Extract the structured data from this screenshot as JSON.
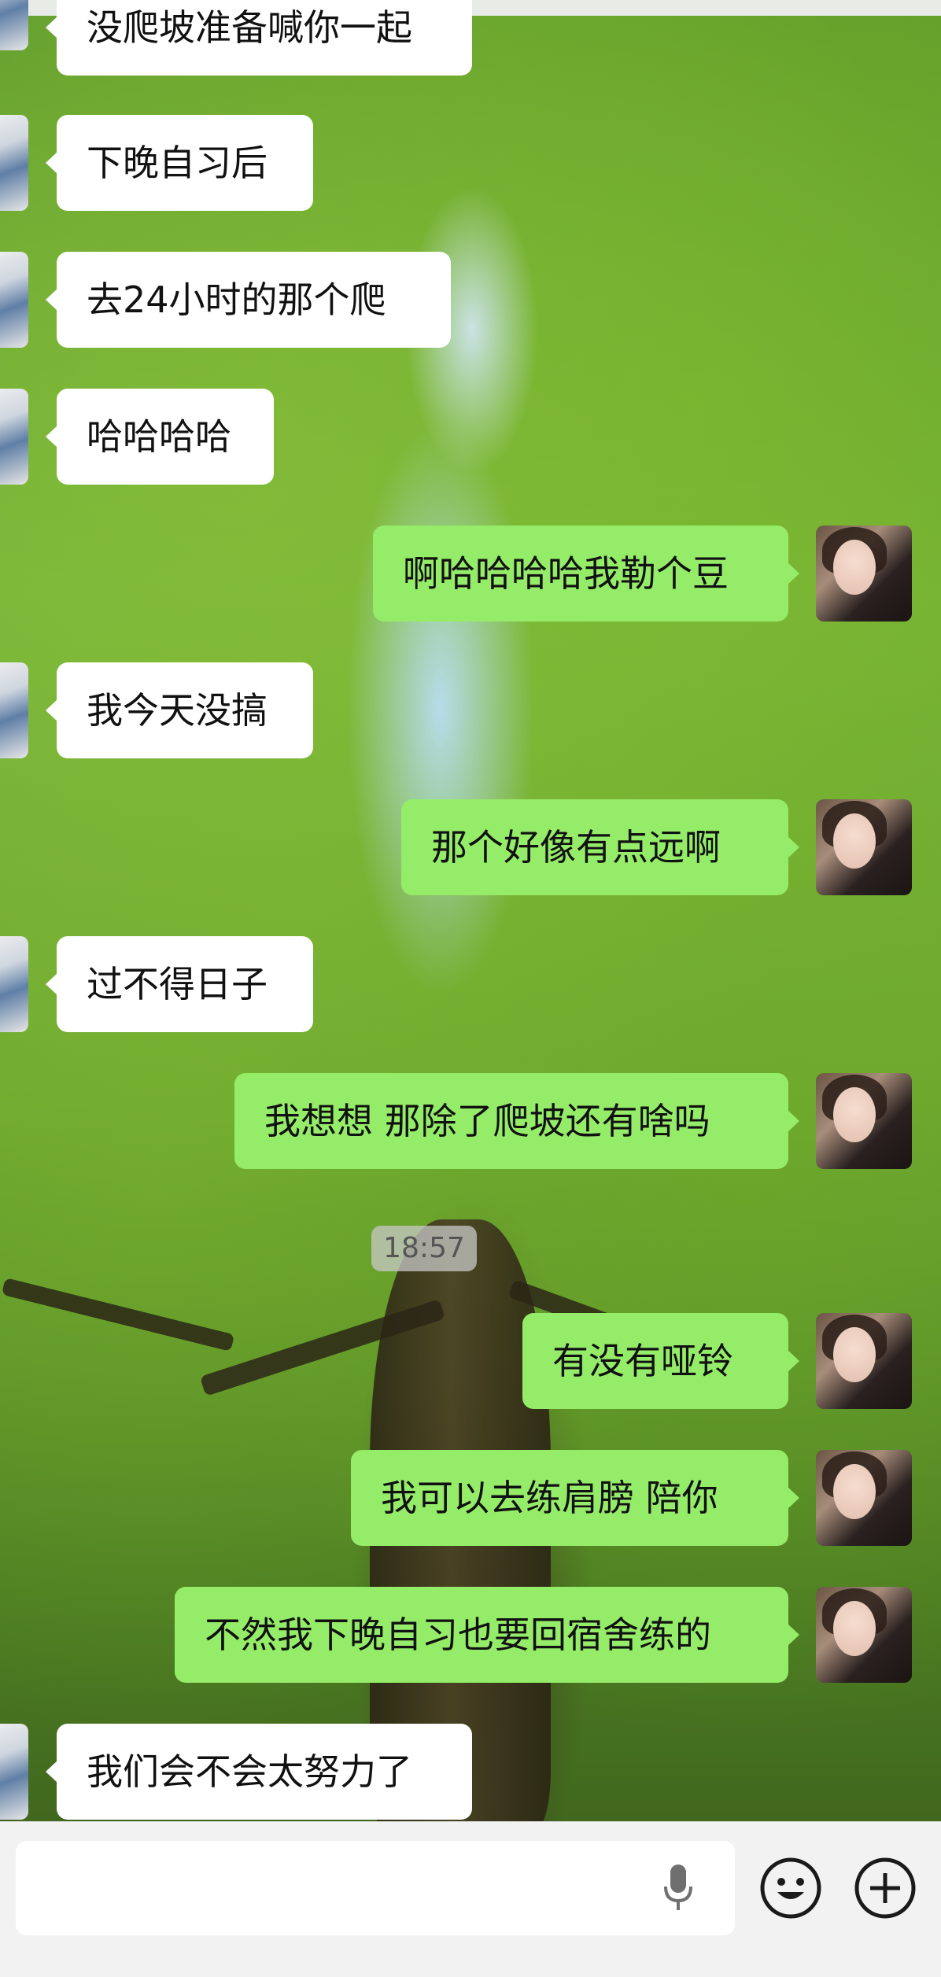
{
  "timestamp": "18:57",
  "messages": [
    {
      "side": "left",
      "text": "没爬坡准备喊你一起"
    },
    {
      "side": "left",
      "text": "下晚自习后"
    },
    {
      "side": "left",
      "text": "去24小时的那个爬"
    },
    {
      "side": "left",
      "text": "哈哈哈哈"
    },
    {
      "side": "right",
      "text": "啊哈哈哈哈我勒个豆"
    },
    {
      "side": "left",
      "text": "我今天没搞"
    },
    {
      "side": "right",
      "text": "那个好像有点远啊"
    },
    {
      "side": "left",
      "text": "过不得日子"
    },
    {
      "side": "right",
      "text": "我想想 那除了爬坡还有啥吗"
    },
    {
      "side": "right",
      "text": "有没有哑铃"
    },
    {
      "side": "right",
      "text": "我可以去练肩膀 陪你"
    },
    {
      "side": "right",
      "text": "不然我下晚自习也要回宿舍练的"
    },
    {
      "side": "left",
      "text": "我们会不会太努力了"
    }
  ],
  "input": {
    "value": ""
  },
  "icons": [
    "voice-input-icon",
    "emoji-icon",
    "more-plus-icon"
  ],
  "colors": {
    "sent_bubble": "#95ec69",
    "received_bubble": "#ffffff"
  }
}
